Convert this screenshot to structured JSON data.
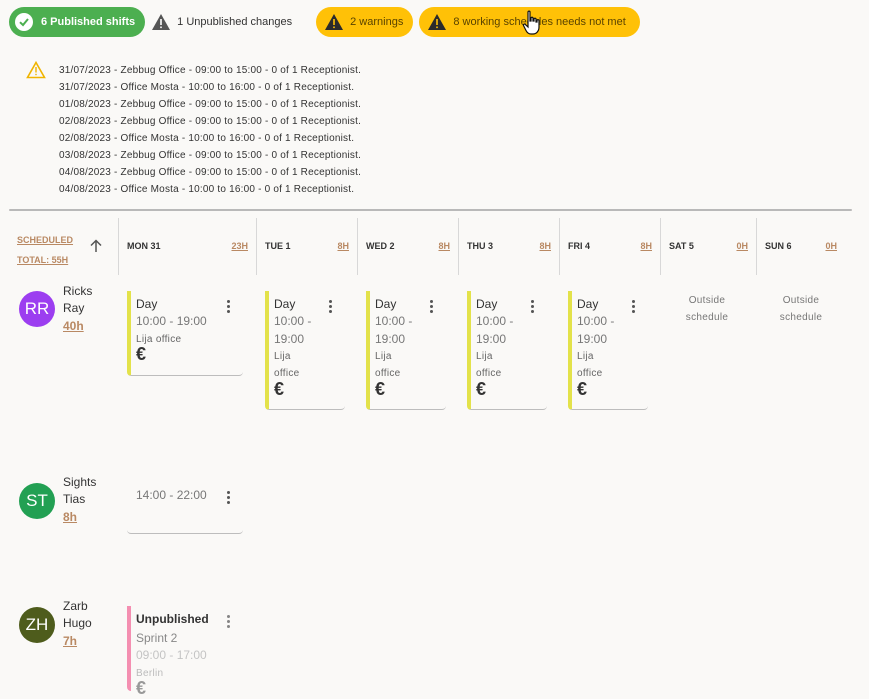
{
  "topbar": {
    "published_label": "6 Published shifts",
    "unpublished_label": "1 Unpublished changes",
    "warnings_label": "2 warnings",
    "schedules_label": "8 working schedules needs not met"
  },
  "warnings": [
    "31/07/2023 - Zebbug Office - 09:00 to 15:00 - 0 of 1 Receptionist.",
    "31/07/2023 - Office Mosta - 10:00 to 16:00 - 0 of 1 Receptionist.",
    "01/08/2023 - Zebbug Office - 09:00 to 15:00 - 0 of 1 Receptionist.",
    "02/08/2023 - Zebbug Office - 09:00 to 15:00 - 0 of 1 Receptionist.",
    "02/08/2023 - Office Mosta - 10:00 to 16:00 - 0 of 1 Receptionist.",
    "03/08/2023 - Zebbug Office - 09:00 to 15:00 - 0 of 1 Receptionist.",
    "04/08/2023 - Zebbug Office - 09:00 to 15:00 - 0 of 1 Receptionist.",
    "04/08/2023 - Office Mosta - 10:00 to 16:00 - 0 of 1 Receptionist."
  ],
  "header": {
    "scheduled_label": "SCHEDULED",
    "total_label": "TOTAL: 55H",
    "days": [
      {
        "day": "MON 31",
        "hours": "23H"
      },
      {
        "day": "TUE 1",
        "hours": "8H"
      },
      {
        "day": "WED 2",
        "hours": "8H"
      },
      {
        "day": "THU 3",
        "hours": "8H"
      },
      {
        "day": "FRI 4",
        "hours": "8H"
      },
      {
        "day": "SAT 5",
        "hours": "0H"
      },
      {
        "day": "SUN 6",
        "hours": "0H"
      }
    ]
  },
  "employees": [
    {
      "initials": "RR",
      "name": "Ricks Ray",
      "hours": "40h",
      "avatar_color": "#9c3ef0"
    },
    {
      "initials": "ST",
      "name": "Sights Tias",
      "hours": "8h",
      "avatar_color": "#22a053"
    },
    {
      "initials": "ZH",
      "name": "Zarb Hugo",
      "hours": "7h",
      "avatar_color": "#4e5c1c"
    }
  ],
  "shifts": {
    "ricks_mon": {
      "title": "Day",
      "time": "10:00 - 19:00",
      "location": "Lija office",
      "currency": "€"
    },
    "ricks_tue": {
      "title": "Day",
      "time1": "10:00 -",
      "time2": "19:00",
      "loc1": "Lija",
      "loc2": "office",
      "currency": "€"
    },
    "ricks_wed": {
      "title": "Day",
      "time1": "10:00 -",
      "time2": "19:00",
      "loc1": "Lija",
      "loc2": "office",
      "currency": "€"
    },
    "ricks_thu": {
      "title": "Day",
      "time1": "10:00 -",
      "time2": "19:00",
      "loc1": "Lija",
      "loc2": "office",
      "currency": "€"
    },
    "ricks_fri": {
      "title": "Day",
      "time1": "10:00 -",
      "time2": "19:00",
      "loc1": "Lija",
      "loc2": "office",
      "currency": "€"
    },
    "outside": [
      "Outside",
      "schedule"
    ],
    "sights_mon": {
      "time": "14:00 - 22:00"
    },
    "zarb_mon": {
      "status": "Unpublished",
      "title": "Sprint 2",
      "time": "09:00 - 17:00",
      "location": "Berlin",
      "currency": "€"
    }
  },
  "colors": {
    "accent": "#b98963",
    "green": "#4caf50",
    "yellow": "#ffc107",
    "shift_bar": "#e3e24a",
    "unpublished": "#f48fb1"
  }
}
